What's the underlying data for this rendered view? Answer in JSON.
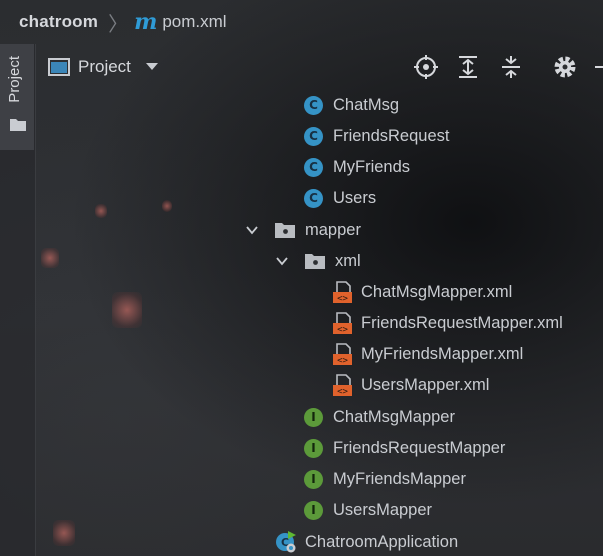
{
  "breadcrumb": {
    "project": "chatroom",
    "file": "pom.xml"
  },
  "toolwindow": {
    "tab_label": "Project",
    "title": "Project"
  },
  "tree": {
    "classes": [
      "ChatMsg",
      "FriendsRequest",
      "MyFriends",
      "Users"
    ],
    "mapper_folder": "mapper",
    "xml_folder": "xml",
    "xml_files": [
      "ChatMsgMapper.xml",
      "FriendsRequestMapper.xml",
      "MyFriendsMapper.xml",
      "UsersMapper.xml"
    ],
    "interfaces": [
      "ChatMsgMapper",
      "FriendsRequestMapper",
      "MyFriendsMapper",
      "UsersMapper"
    ],
    "app_class": "ChatroomApplication"
  },
  "badges": {
    "class": "C",
    "interface": "I"
  },
  "colors": {
    "class_badge": "#3593c6",
    "interface_badge": "#5c9a3a",
    "maven_icon": "#2f9bd6",
    "xml_icon": "#e0622c"
  },
  "icons": [
    "maven-icon",
    "locate-icon",
    "expand-all-icon",
    "collapse-all-icon",
    "gear-icon",
    "folder-icon",
    "xml-file-icon",
    "spring-app-icon"
  ]
}
